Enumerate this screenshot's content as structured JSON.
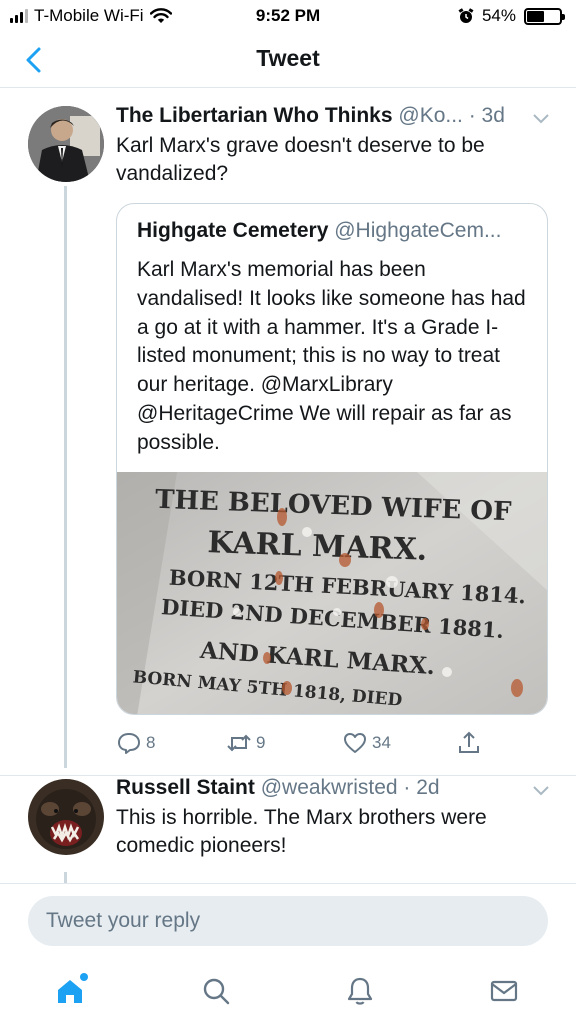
{
  "status_bar": {
    "carrier": "T-Mobile Wi-Fi",
    "time": "9:52 PM",
    "battery_percent": "54%",
    "battery_level": 0.54
  },
  "nav": {
    "title": "Tweet"
  },
  "tweet1": {
    "name": "The Libertarian Who Thinks",
    "handle": "@Ko...",
    "time": "· 3d",
    "text": "Karl Marx's grave doesn't deserve to be vandalized?",
    "quote": {
      "name": "Highgate Cemetery",
      "handle": "@HighgateCem...",
      "text": "Karl Marx's memorial has been vandalised! It looks like someone has had a go at it with a hammer. It's a Grade I-listed monument; this is no way to treat our heritage. @MarxLibrary @HeritageCrime We will repair as far as possible.",
      "image_lines": [
        "THE BELOVED WIFE OF",
        "KARL MARX.",
        "BORN 12TH FEBRUARY 1814.",
        "DIED 2ND DECEMBER 1881.",
        "AND KARL MARX.",
        "BORN MAY 5TH 1818, DIED"
      ]
    },
    "replies": "8",
    "retweets": "9",
    "likes": "34"
  },
  "tweet2": {
    "name": "Russell Staint",
    "handle": "@weakwristed",
    "time": "· 2d",
    "text": "This is horrible. The Marx brothers were comedic pioneers!"
  },
  "reply_bar": {
    "placeholder": "Tweet your reply"
  },
  "tabs": {
    "icons": [
      "home-icon",
      "search-icon",
      "notifications-icon",
      "messages-icon"
    ]
  },
  "colors": {
    "accent": "#1da1f2",
    "secondary_text": "#657786",
    "border": "#ccd6dd"
  }
}
